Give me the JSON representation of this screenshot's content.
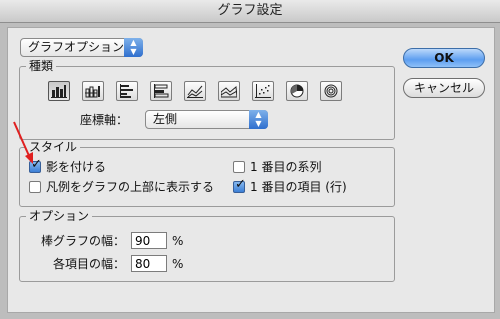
{
  "window": {
    "title": "グラフ設定"
  },
  "header": {
    "popup_value": "グラフオプション"
  },
  "type_group": {
    "label": "種類",
    "icons": [
      {
        "name": "column-graph-icon",
        "selected": true
      },
      {
        "name": "stacked-column-graph-icon",
        "selected": false
      },
      {
        "name": "bar-graph-icon",
        "selected": false
      },
      {
        "name": "stacked-bar-graph-icon",
        "selected": false
      },
      {
        "name": "line-graph-icon",
        "selected": false
      },
      {
        "name": "area-graph-icon",
        "selected": false
      },
      {
        "name": "scatter-graph-icon",
        "selected": false
      },
      {
        "name": "pie-graph-icon",
        "selected": false
      },
      {
        "name": "radar-graph-icon",
        "selected": false
      }
    ],
    "axis_label": "座標軸：",
    "axis_value": "左側"
  },
  "style_group": {
    "label": "スタイル",
    "add_shadow": {
      "label": "影を付ける",
      "checked": true
    },
    "legend_top": {
      "label": "凡例をグラフの上部に表示する",
      "checked": false
    },
    "first_row_front": {
      "label": "1 番目の系列",
      "checked": false
    },
    "first_column_front": {
      "label": "1 番目の項目 (行)",
      "checked": true
    }
  },
  "options_group": {
    "label": "オプション",
    "column_width": {
      "label": "棒グラフの幅：",
      "value": "90",
      "unit": "%"
    },
    "cluster_width": {
      "label": "各項目の幅：",
      "value": "80",
      "unit": "%"
    }
  },
  "buttons": {
    "ok": "OK",
    "cancel": "キャンセル"
  },
  "colors": {
    "accent": "#3c7fd6",
    "annotation_arrow": "#e02020"
  }
}
